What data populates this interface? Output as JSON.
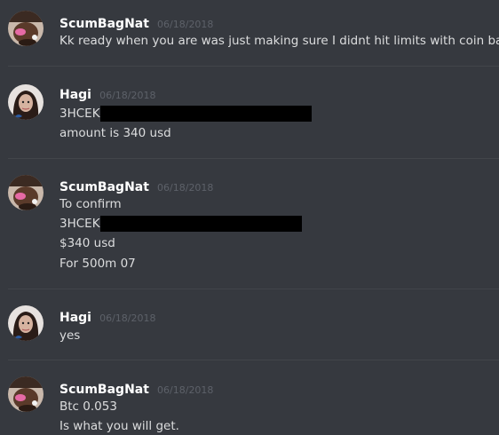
{
  "colors": {
    "background": "#36393f",
    "username": "#ffffff",
    "timestamp": "#5d6169",
    "message_text": "#dcddde",
    "divider": "#42454a",
    "redaction": "#000000"
  },
  "messages": [
    {
      "author": "ScumBagNat",
      "timestamp": "06/18/2018",
      "avatar_icon": "user-avatar-scumbagnat",
      "lines": [
        {
          "text": "Kk ready when you are was just making sure I didnt hit limits with coin base"
        }
      ]
    },
    {
      "author": "Hagi",
      "timestamp": "06/18/2018",
      "avatar_icon": "user-avatar-hagi",
      "lines": [
        {
          "text": "3HCEK",
          "redacted": true
        },
        {
          "text": "amount is 340 usd"
        }
      ]
    },
    {
      "author": "ScumBagNat",
      "timestamp": "06/18/2018",
      "avatar_icon": "user-avatar-scumbagnat",
      "lines": [
        {
          "text": "To confirm"
        },
        {
          "text": "3HCEK",
          "redacted": true
        },
        {
          "text": "$340 usd"
        },
        {
          "text": "For 500m 07"
        }
      ]
    },
    {
      "author": "Hagi",
      "timestamp": "06/18/2018",
      "avatar_icon": "user-avatar-hagi",
      "lines": [
        {
          "text": "yes"
        }
      ]
    },
    {
      "author": "ScumBagNat",
      "timestamp": "06/18/2018",
      "avatar_icon": "user-avatar-scumbagnat",
      "lines": [
        {
          "text": "Btc 0.053"
        },
        {
          "text": "Is what you will get."
        }
      ]
    }
  ]
}
